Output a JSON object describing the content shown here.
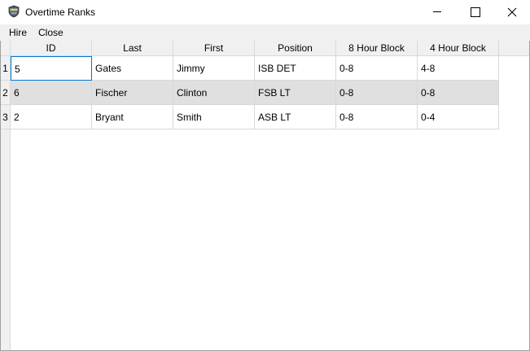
{
  "window": {
    "title": "Overtime Ranks",
    "app_icon": "shield-icon"
  },
  "menu": {
    "items": [
      {
        "label": "Hire"
      },
      {
        "label": "Close"
      }
    ]
  },
  "table": {
    "columns": [
      "ID",
      "Last",
      "First",
      "Position",
      "8 Hour Block",
      "4 Hour Block"
    ],
    "rows": [
      {
        "num": "1",
        "cells": [
          "5",
          "Gates",
          "Jimmy",
          "ISB DET",
          "0-8",
          "4-8"
        ]
      },
      {
        "num": "2",
        "cells": [
          "6",
          "Fischer",
          "Clinton",
          "FSB LT",
          "0-8",
          "0-8"
        ]
      },
      {
        "num": "3",
        "cells": [
          "2",
          "Bryant",
          "Smith",
          "ASB LT",
          "0-8",
          "0-4"
        ]
      }
    ],
    "alternate_row_color": "#e0e0e0",
    "selected_cell_border": "#0078d7"
  }
}
